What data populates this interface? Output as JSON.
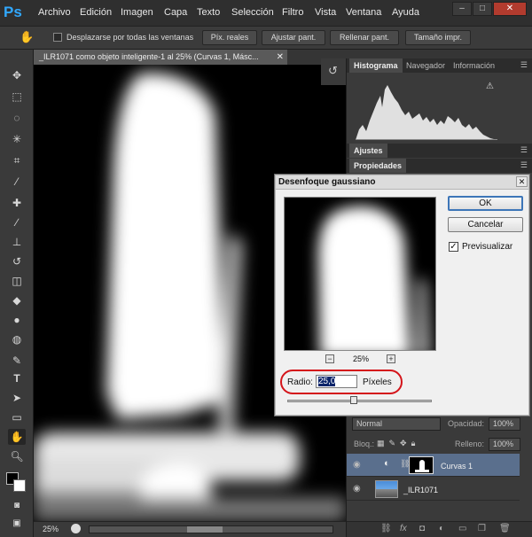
{
  "menubar": {
    "logo": "Ps",
    "items": [
      "Archivo",
      "Edición",
      "Imagen",
      "Capa",
      "Texto",
      "Selección",
      "Filtro",
      "Vista",
      "Ventana",
      "Ayuda"
    ],
    "window_buttons": [
      "–",
      "□",
      "✕"
    ]
  },
  "options_bar": {
    "scroll_all_label": "Desplazarse por todas las ventanas",
    "buttons": [
      "Píx. reales",
      "Ajustar pant.",
      "Rellenar pant.",
      "Tamaño impr."
    ]
  },
  "document": {
    "tab_title": "_ILR1071 como objeto inteligente-1 al 25% (Curvas 1, Másc...",
    "zoom": "25%"
  },
  "panels": {
    "top_tabs": [
      "Histograma",
      "Navegador",
      "Información"
    ],
    "ajustes": "Ajustes",
    "propiedades": "Propiedades"
  },
  "layers": {
    "blend_mode": "Normal",
    "opacity_label": "Opacidad:",
    "opacity_value": "100%",
    "lock_label": "Bloq.:",
    "fill_label": "Relleno:",
    "fill_value": "100%",
    "items": [
      {
        "name": "Curvas 1"
      },
      {
        "name": "_ILR1071"
      }
    ]
  },
  "dialog": {
    "title": "Desenfoque gaussiano",
    "close": "✕",
    "ok": "OK",
    "cancel": "Cancelar",
    "preview_label": "Previsualizar",
    "preview_checked": "✓",
    "zoom_minus": "−",
    "zoom_plus": "+",
    "zoom": "25%",
    "radius_label": "Radio:",
    "radius_value": "25,0",
    "radius_unit": "Píxeles"
  },
  "colors": {
    "accent": "#31a8ff",
    "highlight_oval": "#d4141a",
    "selection": "#0a246a"
  }
}
